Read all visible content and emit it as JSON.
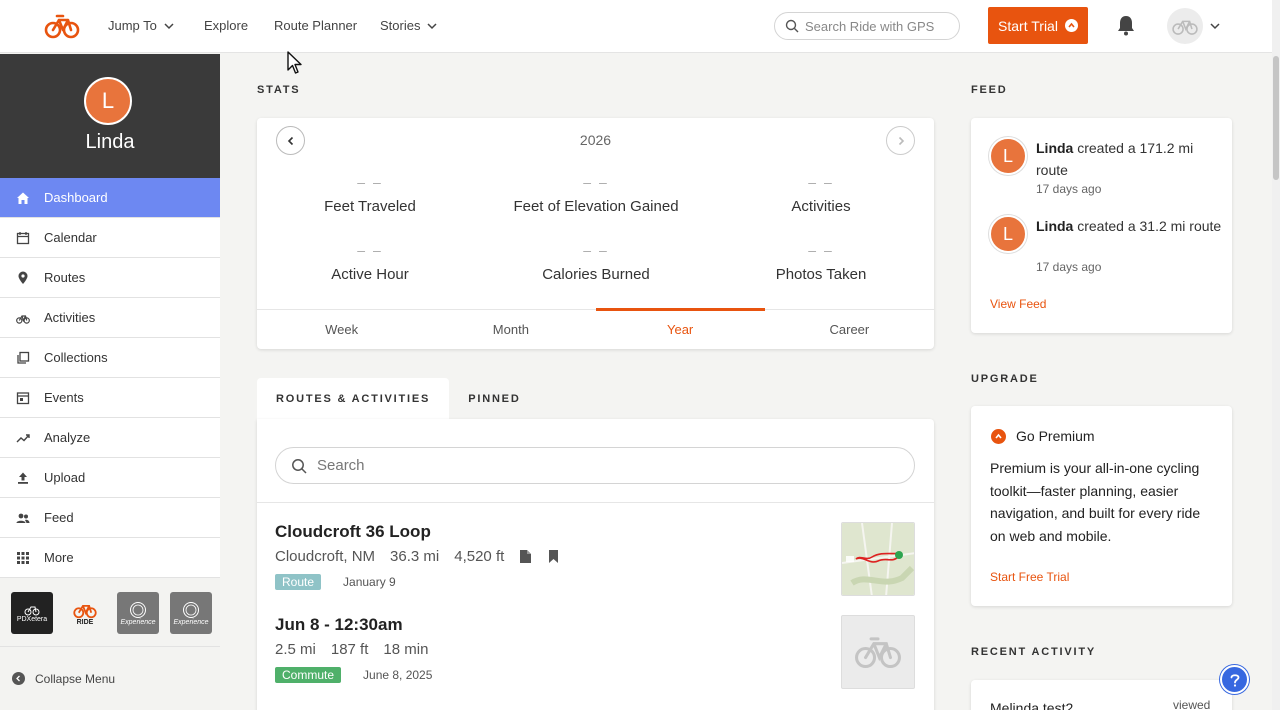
{
  "topbar": {
    "nav": [
      "Jump To",
      "Explore",
      "Route Planner",
      "Stories"
    ],
    "search_placeholder": "Search Ride with GPS",
    "trial_label": "Start Trial"
  },
  "sidebar": {
    "avatar_letter": "L",
    "user_name": "Linda",
    "items": [
      {
        "label": "Dashboard",
        "icon": "home-icon"
      },
      {
        "label": "Calendar",
        "icon": "calendar-icon"
      },
      {
        "label": "Routes",
        "icon": "pin-icon"
      },
      {
        "label": "Activities",
        "icon": "bike-icon"
      },
      {
        "label": "Collections",
        "icon": "collections-icon"
      },
      {
        "label": "Events",
        "icon": "events-icon"
      },
      {
        "label": "Analyze",
        "icon": "trend-icon"
      },
      {
        "label": "Upload",
        "icon": "upload-icon"
      },
      {
        "label": "Feed",
        "icon": "users-icon"
      },
      {
        "label": "More",
        "icon": "grid-icon"
      }
    ],
    "partners": [
      {
        "label": "PDXetera"
      },
      {
        "label": "RIDE"
      },
      {
        "label": "Experience"
      },
      {
        "label": "Experience"
      }
    ],
    "collapse_label": "Collapse Menu"
  },
  "stats": {
    "title": "STATS",
    "year": "2026",
    "items": [
      {
        "value": "– –",
        "label": "Feet Traveled"
      },
      {
        "value": "– –",
        "label": "Feet of Elevation Gained"
      },
      {
        "value": "– –",
        "label": "Activities"
      },
      {
        "value": "– –",
        "label": "Active Hour"
      },
      {
        "value": "– –",
        "label": "Calories Burned"
      },
      {
        "value": "– –",
        "label": "Photos Taken"
      }
    ],
    "tabs": [
      "Week",
      "Month",
      "Year",
      "Career"
    ],
    "active_tab": "Year"
  },
  "routes": {
    "tabs": [
      "ROUTES & ACTIVITIES",
      "PINNED"
    ],
    "search_placeholder": "Search",
    "items": [
      {
        "title": "Cloudcroft 36 Loop",
        "location": "Cloudcroft, NM",
        "distance": "36.3 mi",
        "elevation": "4,520 ft",
        "badge": "Route",
        "date": "January 9"
      },
      {
        "title": "Jun 8 - 12:30am",
        "distance": "2.5 mi",
        "elevation": "187 ft",
        "duration": "18 min",
        "badge": "Commute",
        "date": "June 8, 2025"
      }
    ]
  },
  "feed": {
    "title": "FEED",
    "entries": [
      {
        "letter": "L",
        "name": "Linda",
        "text": " created a 171.2 mi route",
        "time": "17 days ago"
      },
      {
        "letter": "L",
        "name": "Linda",
        "text": " created a 31.2 mi route",
        "time": "17 days ago"
      }
    ],
    "view_link": "View Feed"
  },
  "upgrade": {
    "title": "UPGRADE",
    "heading": "Go Premium",
    "body": "Premium is your all-in-one cycling toolkit—faster planning, easier navigation, and built for every ride on web and mobile.",
    "link": "Start Free Trial"
  },
  "recent": {
    "title": "RECENT ACTIVITY",
    "first_item": "Melinda test2",
    "first_status": "viewed"
  },
  "colors": {
    "accent": "#e8540f",
    "active_menu": "#6d88f2",
    "avatar": "#e8743c"
  }
}
